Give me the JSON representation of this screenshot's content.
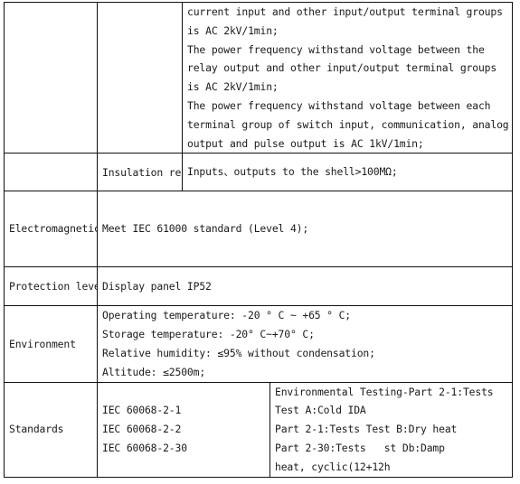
{
  "table": {
    "rows": [
      {
        "id": "dielectric-continued",
        "category": "",
        "subcategory": "",
        "lines": [
          "current input and other input/output terminal groups",
          "is AC 2kV/1min;",
          "The power frequency withstand voltage between the",
          "relay output and other input/output terminal groups",
          "is AC 2kV/1min;",
          "The power frequency withstand voltage between each",
          "terminal group of switch input, communication, analog",
          "output and pulse output is AC 1kV/1min;"
        ]
      },
      {
        "id": "insulation-resistance",
        "category": "",
        "subcategory": "Insulation resistance",
        "lines": [
          "Inputs、outputs to the shell>100MΩ;"
        ]
      },
      {
        "id": "emc",
        "category": "Electromagnetic compatibility",
        "lines": [
          "Meet IEC 61000 standard (Level 4);"
        ]
      },
      {
        "id": "protection-level",
        "category": "Protection level",
        "lines": [
          "Display panel IP52"
        ]
      },
      {
        "id": "environment",
        "category": "Environment",
        "lines": [
          "Operating temperature: -20 ° C ~ +65 ° C;",
          "Storage temperature: -20° C~+70° C;",
          "Relative humidity: ≤95% without condensation;",
          "Altitude: ≤2500m;"
        ]
      },
      {
        "id": "standards",
        "category": "Standards",
        "codes": [
          "IEC 60068-2-1",
          "IEC 60068-2-2",
          "IEC 60068-2-30"
        ],
        "descriptions": [
          "Environmental Testing-Part 2-1:Tests",
          "Test A:Cold IDA",
          "Part 2-1:Tests Test B:Dry heat",
          "Part 2-30:Tests Test Db:Damp",
          "heat, cyclic(12+12h"
        ]
      }
    ]
  }
}
